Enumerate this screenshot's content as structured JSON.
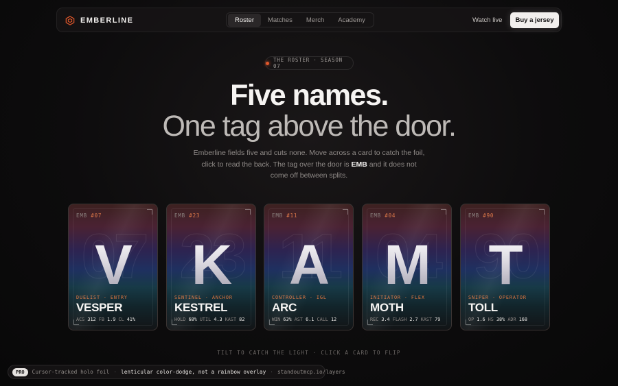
{
  "nav": {
    "brand": "EMBERLINE",
    "links": [
      "Roster",
      "Matches",
      "Merch",
      "Academy"
    ],
    "active": "Roster",
    "watch_live": "Watch live",
    "buy": "Buy a jersey"
  },
  "hero": {
    "pill": "THE ROSTER · SEASON 07",
    "title_line1": "Five names.",
    "title_line2": "One tag above the door.",
    "lede_before": "Emberline fields five and cuts none. Move across a card to catch the foil, click to read the back. The tag over the door is ",
    "lede_bold": "EMB",
    "lede_after": " and it does not come off between splits."
  },
  "cards": [
    {
      "tag_prefix": "EMB ",
      "tag_num": "#07",
      "letter": "V",
      "ghost": "07",
      "role": "DUELIST · ENTRY",
      "name": "VESPER",
      "stats": [
        {
          "k": "ACS",
          "v": "312"
        },
        {
          "k": "FB",
          "v": "1.9"
        },
        {
          "k": "CL",
          "v": "41%"
        }
      ]
    },
    {
      "tag_prefix": "EMB ",
      "tag_num": "#23",
      "letter": "K",
      "ghost": "23",
      "role": "SENTINEL · ANCHOR",
      "name": "KESTREL",
      "stats": [
        {
          "k": "HOLD",
          "v": "68%"
        },
        {
          "k": "UTIL",
          "v": "4.3"
        },
        {
          "k": "KAST",
          "v": "82"
        }
      ]
    },
    {
      "tag_prefix": "EMB ",
      "tag_num": "#11",
      "letter": "A",
      "ghost": "11",
      "role": "CONTROLLER · IGL",
      "name": "ARC",
      "stats": [
        {
          "k": "WIN",
          "v": "63%"
        },
        {
          "k": "AST",
          "v": "6.1"
        },
        {
          "k": "CALL",
          "v": "12"
        }
      ]
    },
    {
      "tag_prefix": "EMB ",
      "tag_num": "#04",
      "letter": "M",
      "ghost": "04",
      "role": "INITIATOR · FLEX",
      "name": "MOTH",
      "stats": [
        {
          "k": "REC",
          "v": "3.4"
        },
        {
          "k": "FLASH",
          "v": "2.7"
        },
        {
          "k": "KAST",
          "v": "79"
        }
      ]
    },
    {
      "tag_prefix": "EMB ",
      "tag_num": "#90",
      "letter": "T",
      "ghost": "90",
      "role": "SNIPER · OPERATOR",
      "name": "TOLL",
      "stats": [
        {
          "k": "OP",
          "v": "1.6"
        },
        {
          "k": "HS",
          "v": "38%"
        },
        {
          "k": "ADR",
          "v": "168"
        }
      ]
    }
  ],
  "hint": "TILT TO CATCH THE LIGHT · CLICK A CARD TO FLIP",
  "badge": {
    "pro": "PRO",
    "text1": "Cursor-tracked holo foil",
    "sep": "·",
    "text2": "lenticular color-dodge, not a rainbow overlay",
    "link": "standoutmcp.io/layers"
  },
  "colors": {
    "accent": "#e2572b",
    "role": "#e0773f"
  }
}
